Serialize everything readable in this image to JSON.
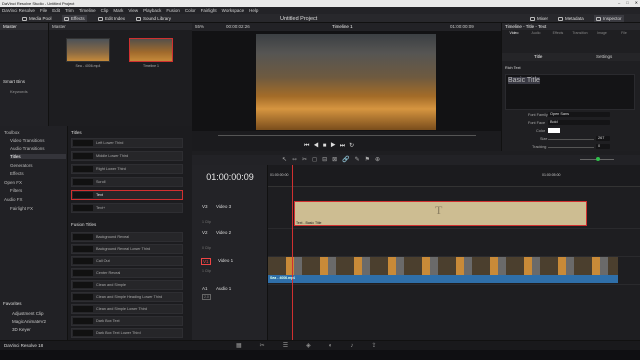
{
  "window": {
    "title": "DaVinci Resolve Studio - Untitled Project"
  },
  "menu": [
    "DaVinci Resolve",
    "File",
    "Edit",
    "Trim",
    "Timeline",
    "Clip",
    "Mark",
    "View",
    "Playback",
    "Fusion",
    "Color",
    "Fairlight",
    "Workspace",
    "Help"
  ],
  "toolbar": {
    "media_pool": "Media Pool",
    "effects": "Effects",
    "edit_index": "Edit Index",
    "sound_library": "Sound Library",
    "project_title": "Untitled Project",
    "mixer": "Mixer",
    "metadata": "Metadata",
    "inspector": "Inspector"
  },
  "media_pool": {
    "master_label": "Master",
    "bin_master": "Master",
    "smart_bins": "Smart Bins",
    "keywords": "Keywords",
    "clips": [
      {
        "label": "Sea - 4006.mp4"
      },
      {
        "label": "Timeline 1"
      }
    ]
  },
  "viewer": {
    "zoom": "55%",
    "source_tc": "00:00:02:26",
    "timeline_name": "Timeline 1",
    "record_tc": "01:00:00:09"
  },
  "inspector": {
    "title": "Timeline - Title - Text",
    "tabs": [
      "Video",
      "Audio",
      "Effects",
      "Transition",
      "Image",
      "File"
    ],
    "subtabs": [
      "Title",
      "Settings"
    ],
    "section": "Rich Text",
    "text_value": "Basic Title",
    "font_family_label": "Font Family",
    "font_family": "Open Sans",
    "font_face_label": "Font Face",
    "font_face": "Bold",
    "color_label": "Color",
    "size_label": "Size",
    "size": "267",
    "tracking_label": "Tracking",
    "tracking": "0"
  },
  "effects": {
    "tree": [
      "Toolbox",
      "Video Transitions",
      "Audio Transitions",
      "Titles",
      "Generators",
      "Effects",
      "Open FX",
      "Filters",
      "Audio FX",
      "Fairlight FX"
    ],
    "titles_header": "Titles",
    "titles": [
      "Left Lower Third",
      "Middle Lower Third",
      "Right Lower Third",
      "Scroll",
      "Text",
      "Text+"
    ],
    "fusion_header": "Fusion Titles",
    "fusion": [
      "Background Reveal",
      "Background Reveal Lower Third",
      "Call Out",
      "Center Reveal",
      "Clean and Simple",
      "Clean and Simple Heading Lower Third",
      "Clean and Simple Lower Third",
      "Dark Box Text",
      "Dark Box Text Lower Third"
    ]
  },
  "favorites": {
    "header": "Favorites",
    "items": [
      "Adjustment Clip",
      "MagicAnimateV2",
      "3D Keyer"
    ]
  },
  "timeline": {
    "timecode": "01:00:00:09",
    "ruler": [
      "01:00:00:00",
      "01:00:05:00"
    ],
    "tracks": [
      {
        "id": "V3",
        "name": "Video 3",
        "count": "1 Clip"
      },
      {
        "id": "V2",
        "name": "Video 2",
        "count": "0 Clip"
      },
      {
        "id": "V1",
        "name": "Video 1",
        "count": "1 Clip"
      },
      {
        "id": "A1",
        "name": "Audio 1",
        "count": "2.0"
      }
    ],
    "clip_text": "Text - Basic Title",
    "clip_video": "Sea - 4006.mp4",
    "clip_audio": "Sea - 4006.mp4"
  },
  "app_footer": "DaVinci Resolve 18",
  "colors": {
    "accent": "#d03030",
    "audio": "#2f6fa9"
  }
}
